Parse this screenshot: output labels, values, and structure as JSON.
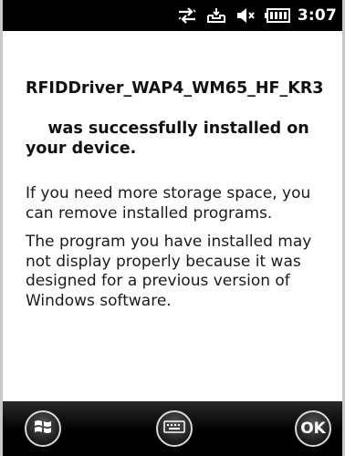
{
  "status_bar": {
    "icons": [
      "sync-arrows-icon",
      "inbox-icon",
      "speaker-off-icon",
      "battery-icon"
    ],
    "time": "3:07"
  },
  "message": {
    "title_line1": "RFIDDriver_WAP4_WM65_HF_KR3",
    "title_rest": "was successfully installed on your device.",
    "paragraph1": "If you need more storage space, you can remove installed programs.",
    "paragraph2": "The program you have installed may not display properly because it was designed for a previous version of Windows software."
  },
  "bottom_bar": {
    "ok_label": "OK",
    "start_icon": "windows-start-icon",
    "keyboard_icon": "keyboard-icon"
  },
  "colors": {
    "status_bar_bg": "#000000",
    "title_text": "#111111"
  }
}
